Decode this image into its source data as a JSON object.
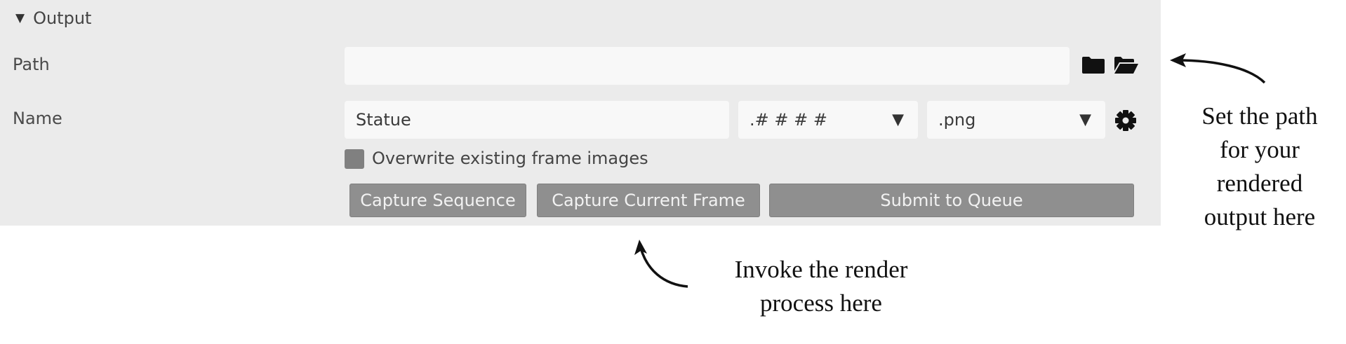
{
  "section": {
    "title": "Output"
  },
  "path_row": {
    "label": "Path",
    "value": ""
  },
  "name_row": {
    "label": "Name",
    "name_value": "Statue",
    "padding_value": ".# # # #",
    "format_value": ".png"
  },
  "overwrite": {
    "label": "Overwrite existing frame images",
    "checked": false
  },
  "buttons": {
    "capture_sequence": "Capture Sequence",
    "capture_current_frame": "Capture Current Frame",
    "submit_to_queue": "Submit to Queue"
  },
  "annotations": {
    "path_note": [
      "Set the path",
      "for your",
      "rendered",
      "output here"
    ],
    "render_note": [
      "Invoke the render",
      "process here"
    ]
  },
  "icons": {
    "folder": "folder-icon",
    "folder_open": "folder-open-icon",
    "gear": "gear-icon",
    "dropdown": "triangle-down-icon"
  }
}
